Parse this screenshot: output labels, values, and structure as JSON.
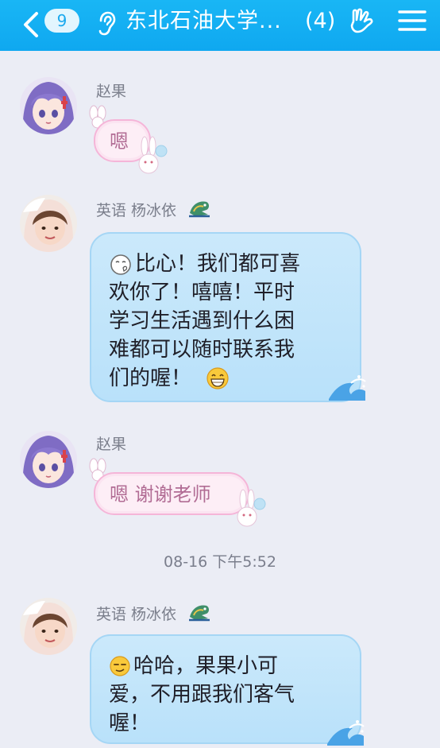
{
  "header": {
    "unread_count": "9",
    "title": "东北石油大学...",
    "member_count": "(4)"
  },
  "messages": [
    {
      "sender": "赵果",
      "text": "嗯"
    },
    {
      "sender": "英语 杨冰依",
      "text_lines": [
        "比心！我们都可喜",
        "欢你了！嘻嘻！平时",
        "学习生活遇到什么困",
        "难都可以随时联系我",
        "们的喔！"
      ]
    },
    {
      "sender": "赵果",
      "text": "嗯 谢谢老师"
    },
    {
      "sender": "英语 杨冰依",
      "text_lines": [
        "哈哈，果果小可",
        "爱，不用跟我们客气",
        "喔！"
      ]
    }
  ],
  "timestamp": "08-16 下午5:52",
  "colors": {
    "header": "#12aef2",
    "pink_bubble": "#fdeef6",
    "blue_bubble": "#c4e6fb"
  },
  "icons": [
    "back-chevron-icon",
    "ear-icon",
    "hand-gesture-icon",
    "menu-icon",
    "heart-hands-emoji-icon",
    "grin-emoji-icon",
    "smirk-emoji-icon",
    "dragon-badge-icon",
    "bunny-decoration-icon",
    "wave-decoration-icon"
  ]
}
